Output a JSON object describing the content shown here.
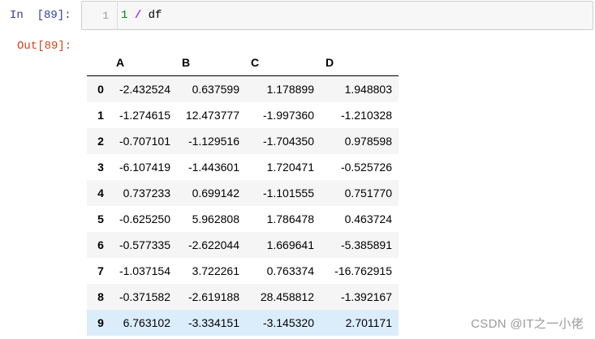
{
  "prompts": {
    "in": "In  [89]:",
    "out": "Out[89]:"
  },
  "input_cell": {
    "line_number": "1",
    "code": {
      "number": "1",
      "operator": "/",
      "name": "df"
    }
  },
  "table": {
    "columns": [
      "A",
      "B",
      "C",
      "D"
    ],
    "rows": [
      {
        "index": "0",
        "values": [
          "-2.432524",
          "0.637599",
          "1.178899",
          "1.948803"
        ]
      },
      {
        "index": "1",
        "values": [
          "-1.274615",
          "12.473777",
          "-1.997360",
          "-1.210328"
        ]
      },
      {
        "index": "2",
        "values": [
          "-0.707101",
          "-1.129516",
          "-1.704350",
          "0.978598"
        ]
      },
      {
        "index": "3",
        "values": [
          "-6.107419",
          "-1.443601",
          "1.720471",
          "-0.525726"
        ]
      },
      {
        "index": "4",
        "values": [
          "0.737233",
          "0.699142",
          "-1.101555",
          "0.751770"
        ]
      },
      {
        "index": "5",
        "values": [
          "-0.625250",
          "5.962808",
          "1.786478",
          "0.463724"
        ]
      },
      {
        "index": "6",
        "values": [
          "-0.577335",
          "-2.622044",
          "1.669641",
          "-5.385891"
        ]
      },
      {
        "index": "7",
        "values": [
          "-1.037154",
          "3.722261",
          "0.763374",
          "-16.762915"
        ]
      },
      {
        "index": "8",
        "values": [
          "-0.371582",
          "-2.619188",
          "28.458812",
          "-1.392167"
        ]
      },
      {
        "index": "9",
        "values": [
          "6.763102",
          "-3.334151",
          "-3.145320",
          "2.701171"
        ]
      }
    ],
    "hovered_row": "9"
  },
  "watermark": "CSDN @IT之一小佬",
  "colors": {
    "in_prompt": "#303f9f",
    "out_prompt": "#d84315",
    "hover_row": "#dbedfb"
  }
}
